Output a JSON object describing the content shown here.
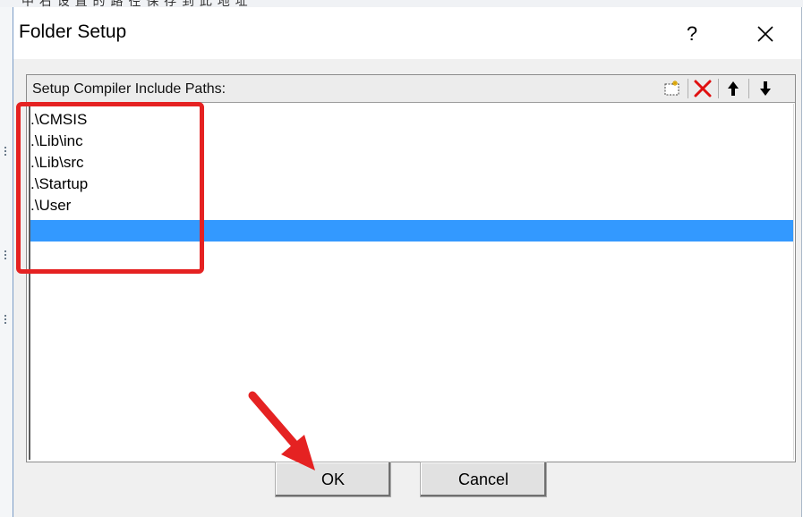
{
  "background_caption": "中 右 设 置 的 路 径 保 存 到 此 地 址",
  "window": {
    "title": "Folder Setup",
    "help_label": "?",
    "close_icon": "close-icon"
  },
  "group": {
    "label": "Setup Compiler Include Paths:",
    "toolbar": {
      "new_icon": "new-folder-icon",
      "delete_icon": "delete-icon",
      "move_up_icon": "arrow-up-icon",
      "move_down_icon": "arrow-down-icon",
      "delete_color": "#e01010"
    }
  },
  "paths": [
    ".\\CMSIS",
    ".\\Lib\\inc",
    ".\\Lib\\src",
    ".\\Startup",
    ".\\User"
  ],
  "selected_row_color": "#3399ff",
  "buttons": {
    "ok_label": "OK",
    "cancel_label": "Cancel"
  },
  "annotation_color": "#e52222"
}
